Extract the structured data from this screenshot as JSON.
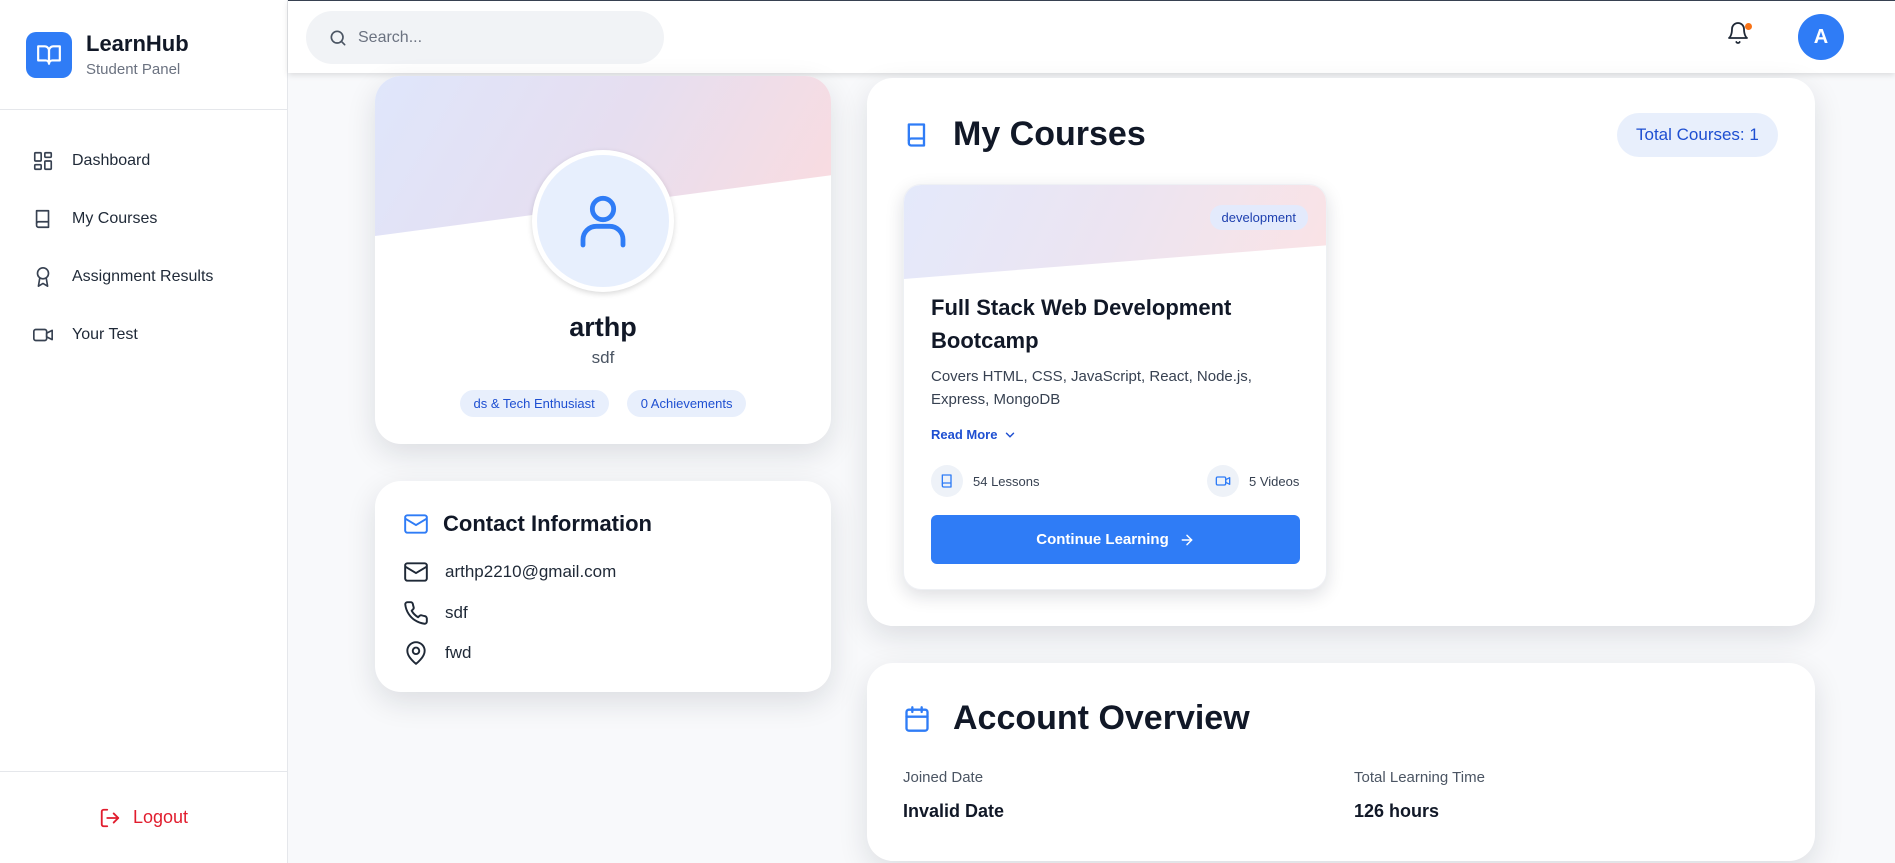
{
  "brand": {
    "title": "LearnHub",
    "subtitle": "Student Panel"
  },
  "sidebar": {
    "items": [
      {
        "label": "Dashboard",
        "icon": "grid-icon"
      },
      {
        "label": "My Courses",
        "icon": "book-icon"
      },
      {
        "label": "Assignment Results",
        "icon": "award-icon"
      },
      {
        "label": "Your Test",
        "icon": "video-icon"
      }
    ],
    "logout_label": "Logout"
  },
  "header": {
    "search_placeholder": "Search...",
    "avatar_initial": "A"
  },
  "profile": {
    "name": "arthp",
    "subtitle": "sdf",
    "badges": [
      "ds & Tech Enthusiast",
      "0 Achievements"
    ]
  },
  "contact": {
    "title": "Contact Information",
    "email": "arthp2210@gmail.com",
    "phone": "sdf",
    "location": "fwd"
  },
  "courses": {
    "title": "My Courses",
    "total_label": "Total Courses: 1",
    "items": [
      {
        "category": "development",
        "title": "Full Stack Web Development Bootcamp",
        "description": "Covers HTML, CSS, JavaScript, React, Node.js, Express, MongoDB",
        "read_more": "Read More",
        "lessons": "54 Lessons",
        "videos": "5 Videos",
        "button": "Continue Learning"
      }
    ]
  },
  "overview": {
    "title": "Account Overview",
    "joined_label": "Joined Date",
    "joined_value": "Invalid Date",
    "time_label": "Total Learning Time",
    "time_value": "126 hours"
  },
  "colors": {
    "accent": "#2f7cf6",
    "logout": "#e11d2e",
    "notification_dot": "#f97316"
  }
}
